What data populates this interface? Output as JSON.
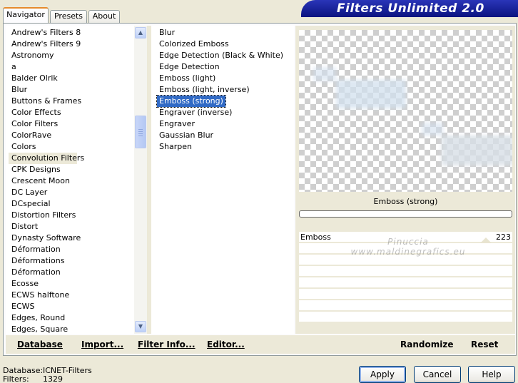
{
  "tabs": [
    {
      "label": "Navigator",
      "active": true
    },
    {
      "label": "Presets",
      "active": false
    },
    {
      "label": "About",
      "active": false
    }
  ],
  "banner_title": "Filters Unlimited 2.0",
  "categories": [
    "Andrew's Filters 8",
    "Andrew's Filters 9",
    "Astronomy",
    "a",
    "Balder Olrik",
    "Blur",
    "Buttons & Frames",
    "Color Effects",
    "Color Filters",
    "ColorRave",
    "Colors",
    "Convolution Filters",
    "CPK Designs",
    "Crescent Moon",
    "DC Layer",
    "DCspecial",
    "Distortion Filters",
    "Distort",
    "Dynasty Software",
    "Déformation",
    "Déformations",
    "Déformation",
    "Ecosse",
    "ECWS halftone",
    "ECWS",
    "Edges, Round",
    "Edges, Square"
  ],
  "selected_category": "Convolution Filters",
  "filters": [
    "Blur",
    "Colorized Emboss",
    "Edge Detection (Black & White)",
    "Edge Detection",
    "Emboss (light)",
    "Emboss (light, inverse)",
    "Emboss (strong)",
    "Engraver (inverse)",
    "Engraver",
    "Gaussian Blur",
    "Sharpen"
  ],
  "selected_filter": "Emboss (strong)",
  "preview": {
    "filter_name": "Emboss (strong)",
    "progress": 0
  },
  "parameters": [
    {
      "name": "Emboss",
      "value": "223"
    }
  ],
  "watermark": {
    "line1": "Pinuccia",
    "line2": "www.maldinegrafics.eu"
  },
  "bottom_buttons": {
    "database": "Database",
    "import": "Import...",
    "filter_info": "Filter Info...",
    "editor": "Editor...",
    "randomize": "Randomize",
    "reset": "Reset"
  },
  "status": {
    "database_label": "Database:",
    "database_value": "ICNET-Filters",
    "filters_label": "Filters:",
    "filters_value": "1329"
  },
  "dialog_buttons": {
    "apply": "Apply",
    "cancel": "Cancel",
    "help": "Help"
  },
  "colors": {
    "selection": "#316ac5",
    "banner": "#0b1380",
    "window_bg": "#ece9d8"
  }
}
